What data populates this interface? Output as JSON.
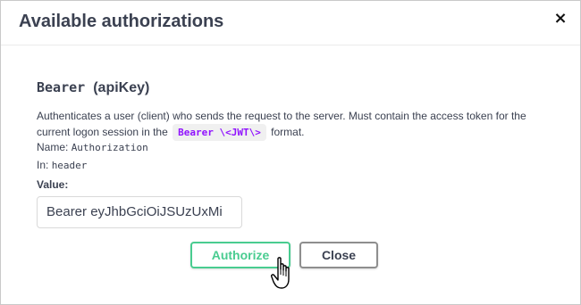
{
  "modal": {
    "title": "Available authorizations",
    "close_glyph": "×"
  },
  "scheme": {
    "name": "Bearer",
    "type": "(apiKey)",
    "description_before": "Authenticates a user (client) who sends the request to the server. Must contain the access token for the current logon session in the",
    "code": "Bearer \\<JWT\\>",
    "description_after": "format.",
    "name_label": "Name:",
    "name_value": "Authorization",
    "in_label": "In:",
    "in_value": "header",
    "value_label": "Value:",
    "value_input": "Bearer eyJhbGciOiJSUzUxMi"
  },
  "buttons": {
    "authorize": "Authorize",
    "close": "Close"
  },
  "colors": {
    "authorize": "#49cc90",
    "code_text": "#9012fe"
  },
  "cursor": "hand-pointer-icon"
}
